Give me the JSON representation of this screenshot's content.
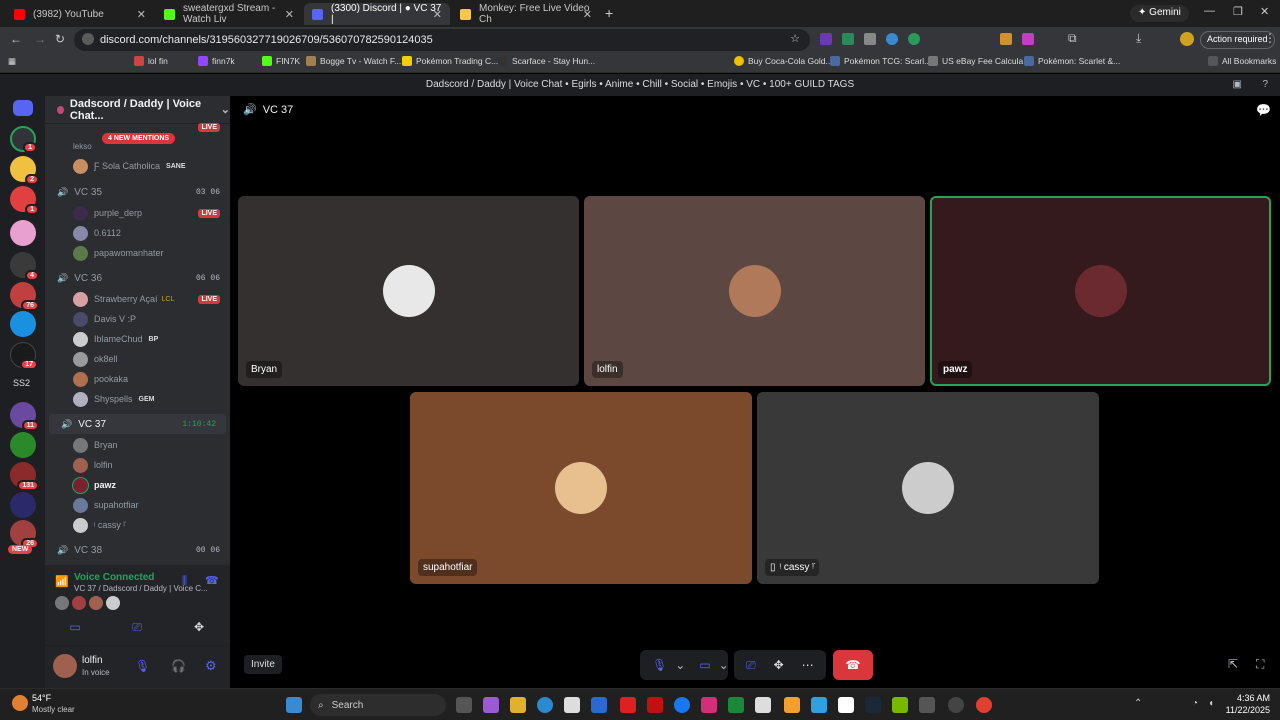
{
  "browser": {
    "tabs": [
      {
        "title": "(3982) YouTube",
        "color": "#ff0000"
      },
      {
        "title": "sweatergxd Stream - Watch Liv",
        "color": "#53fc18"
      },
      {
        "title": "(3300) Discord | ● VC 37 |",
        "color": "#5865f2"
      },
      {
        "title": "Monkey: Free Live Video Ch",
        "color": "#f9c74f"
      }
    ],
    "gemini_label": "Gemini",
    "url": "discord.com/channels/319560327719026709/536070782590124035",
    "action_required": "Action required",
    "bookmarks": [
      "lol fin",
      "finn7k",
      "FIN7K",
      "Bogge Tv - Watch F...",
      "Pokémon Trading C...",
      "Scarface - Stay Hun...",
      "Buy Coca-Cola Gold...",
      "Pokémon TCG: Scarl...",
      "US eBay Fee Calcula...",
      "Pokémon: Scarlet &..."
    ],
    "all_bookmarks": "All Bookmarks"
  },
  "discord": {
    "window_title": "Dadscord / Daddy | Voice Chat • Egirls • Anime • Chill • Social • Emojis • VC • 100+ GUILD TAGS",
    "server_name": "Dadscord / Daddy | Voice Chat...",
    "new_mentions": "4 NEW MENTIONS",
    "top_users": [
      {
        "name": "lekso",
        "color": "#7a6a5a"
      },
      {
        "name": "Ƒ Sola Catholica",
        "tag": "SANE",
        "color": "#c89060"
      }
    ],
    "top_live": "LIVE",
    "channels": [
      {
        "name": "VC 35",
        "count": "03  06",
        "users": [
          {
            "name": "purple_derp",
            "live": "LIVE",
            "color": "#3b2a4a"
          },
          {
            "name": "0.6112",
            "color": "#88a"
          },
          {
            "name": "papawomanhater",
            "color": "#5a7a4a"
          }
        ]
      },
      {
        "name": "VC 36",
        "count": "06  06",
        "users": [
          {
            "name": "Strawberry Açaí",
            "tag": "LCL",
            "live": "LIVE",
            "color": "#d8a0a0"
          },
          {
            "name": "Davis V :P",
            "color": "#4a4a6a"
          },
          {
            "name": "IblameChud",
            "tag": "BP",
            "color": "#ccc"
          },
          {
            "name": "ok8ell",
            "color": "#9a9a9a"
          },
          {
            "name": "pookaka",
            "color": "#b07050"
          },
          {
            "name": "Shyspells",
            "tag": "GEM",
            "color": "#b0b0c0"
          }
        ]
      },
      {
        "name": "VC 37",
        "count": "1:10:42",
        "users": [
          {
            "name": "Bryan",
            "color": "#777"
          },
          {
            "name": "lolfin",
            "color": "#a06050"
          },
          {
            "name": "pawz",
            "color": "#7a2030"
          },
          {
            "name": "supahotfiar",
            "color": "#6a7a9a"
          },
          {
            "name": "ᵎ cassy ᵎ̈",
            "color": "#ccc"
          }
        ]
      },
      {
        "name": "VC 38",
        "count": "00  06",
        "users": []
      }
    ],
    "voice": {
      "status": "Voice Connected",
      "location": "VC 37 / Dadscord / Daddy | Voice C..."
    },
    "user": {
      "name": "lolfin",
      "status": "In voice"
    },
    "header_channel": "VC 37",
    "tiles": [
      {
        "name": "Bryan",
        "bg": "#34302f",
        "avatar": "#e8e8e8"
      },
      {
        "name": "lolfin",
        "bg": "#5c4742",
        "avatar": "#b07a5a"
      },
      {
        "name": "pawz",
        "bg": "#34191d",
        "avatar": "#6a2a30"
      },
      {
        "name": "supahotfiar",
        "bg": "#7b4a2d",
        "avatar": "#e8c090"
      },
      {
        "name": "ᵎ cassy ᵎ̈",
        "bg": "#383938",
        "avatar": "#ccc"
      }
    ],
    "invite": "Invite",
    "servers": [
      {
        "color": "#f0c040",
        "badge": "2"
      },
      {
        "color": "#e04040",
        "badge": "1"
      },
      {
        "color": "#e8a0d0",
        "badge": ""
      },
      {
        "color": "#3a3a3a",
        "badge": "4"
      },
      {
        "color": "#c04040",
        "badge": "76"
      },
      {
        "color": "#1a90e0",
        "badge": ""
      },
      {
        "color": "#1a1a1a",
        "badge": "17"
      },
      {
        "color": "#555",
        "badge": ""
      },
      {
        "color": "#6a4aa0",
        "badge": "11"
      },
      {
        "color": "#2a8a2a",
        "badge": ""
      },
      {
        "color": "#8a2a2a",
        "badge": "131"
      },
      {
        "color": "#2a2a6a",
        "badge": ""
      },
      {
        "color": "#a04040",
        "badge": "26"
      }
    ],
    "server_labels": {
      "ss2": "SS2",
      "new": "NEW"
    }
  },
  "taskbar": {
    "weather_temp": "54°F",
    "weather_desc": "Mostly clear",
    "search": "Search",
    "time": "4:36 AM",
    "date": "11/22/2025"
  }
}
